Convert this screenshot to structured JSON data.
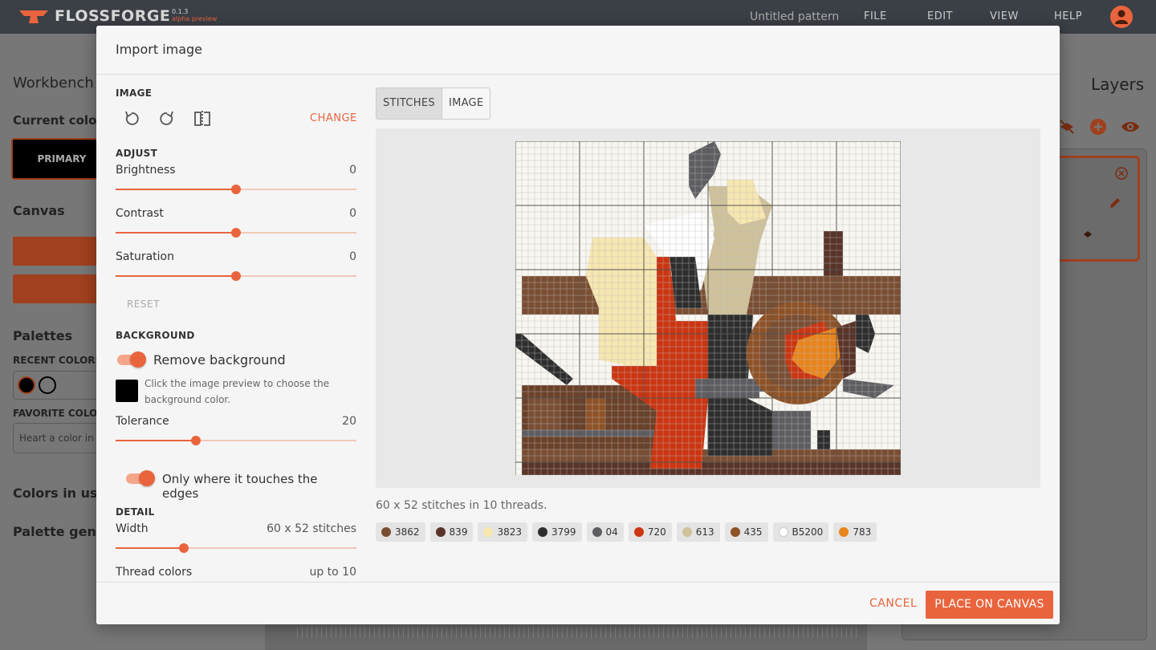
{
  "app": {
    "name": "FLOSSFORGE",
    "version": "0.1.3",
    "version_note": "alpha preview",
    "pattern_title": "Untitled pattern",
    "menu": [
      "FILE",
      "EDIT",
      "VIEW",
      "HELP"
    ]
  },
  "background": {
    "workbench": "Workbench",
    "current_color": "Current color",
    "primary": "PRIMARY",
    "canvas": "Canvas",
    "palettes": "Palettes",
    "recent_colors": "RECENT COLORS",
    "favorite_colors": "FAVORITE COLORS",
    "favorite_placeholder": "Heart a color in the",
    "colors_in_use": "Colors in use",
    "palette_generator": "Palette generator",
    "layers": "Layers"
  },
  "modal": {
    "title": "Import image",
    "image_section": "IMAGE",
    "change_label": "CHANGE",
    "adjust_section": "ADJUST",
    "brightness": {
      "label": "Brightness",
      "value": "0",
      "level": 0.5
    },
    "contrast": {
      "label": "Contrast",
      "value": "0",
      "level": 0.5
    },
    "saturation": {
      "label": "Saturation",
      "value": "0",
      "level": 0.5
    },
    "reset_label": "RESET",
    "background_section": "BACKGROUND",
    "remove_background": {
      "label": "Remove background",
      "on": true
    },
    "bg_hint": "Click the image preview to choose the background color.",
    "bg_color": "#000000",
    "tolerance": {
      "label": "Tolerance",
      "value": "20",
      "level": 0.333
    },
    "edges_toggle": {
      "label": "Only where it touches the edges",
      "on": true
    },
    "detail_section": "DETAIL",
    "width": {
      "label": "Width",
      "value": "60 x 52 stitches",
      "level": 0.283
    },
    "thread_colors": {
      "label": "Thread colors",
      "value": "up to 10"
    },
    "tabs": [
      "STITCHES",
      "IMAGE"
    ],
    "active_tab": "STITCHES",
    "summary": "60 x 52 stitches in 10 threads.",
    "threads": [
      {
        "code": "3862",
        "color": "#7a4e33"
      },
      {
        "code": "839",
        "color": "#5a3428"
      },
      {
        "code": "3823",
        "color": "#f7e7b0"
      },
      {
        "code": "3799",
        "color": "#2e2e2e"
      },
      {
        "code": "04",
        "color": "#5e5e62"
      },
      {
        "code": "720",
        "color": "#cc3511"
      },
      {
        "code": "613",
        "color": "#cfc19a"
      },
      {
        "code": "435",
        "color": "#8e5226"
      },
      {
        "code": "B5200",
        "color": "#ffffff"
      },
      {
        "code": "783",
        "color": "#e8841c"
      }
    ],
    "cancel_label": "CANCEL",
    "place_label": "PLACE ON CANVAS"
  }
}
